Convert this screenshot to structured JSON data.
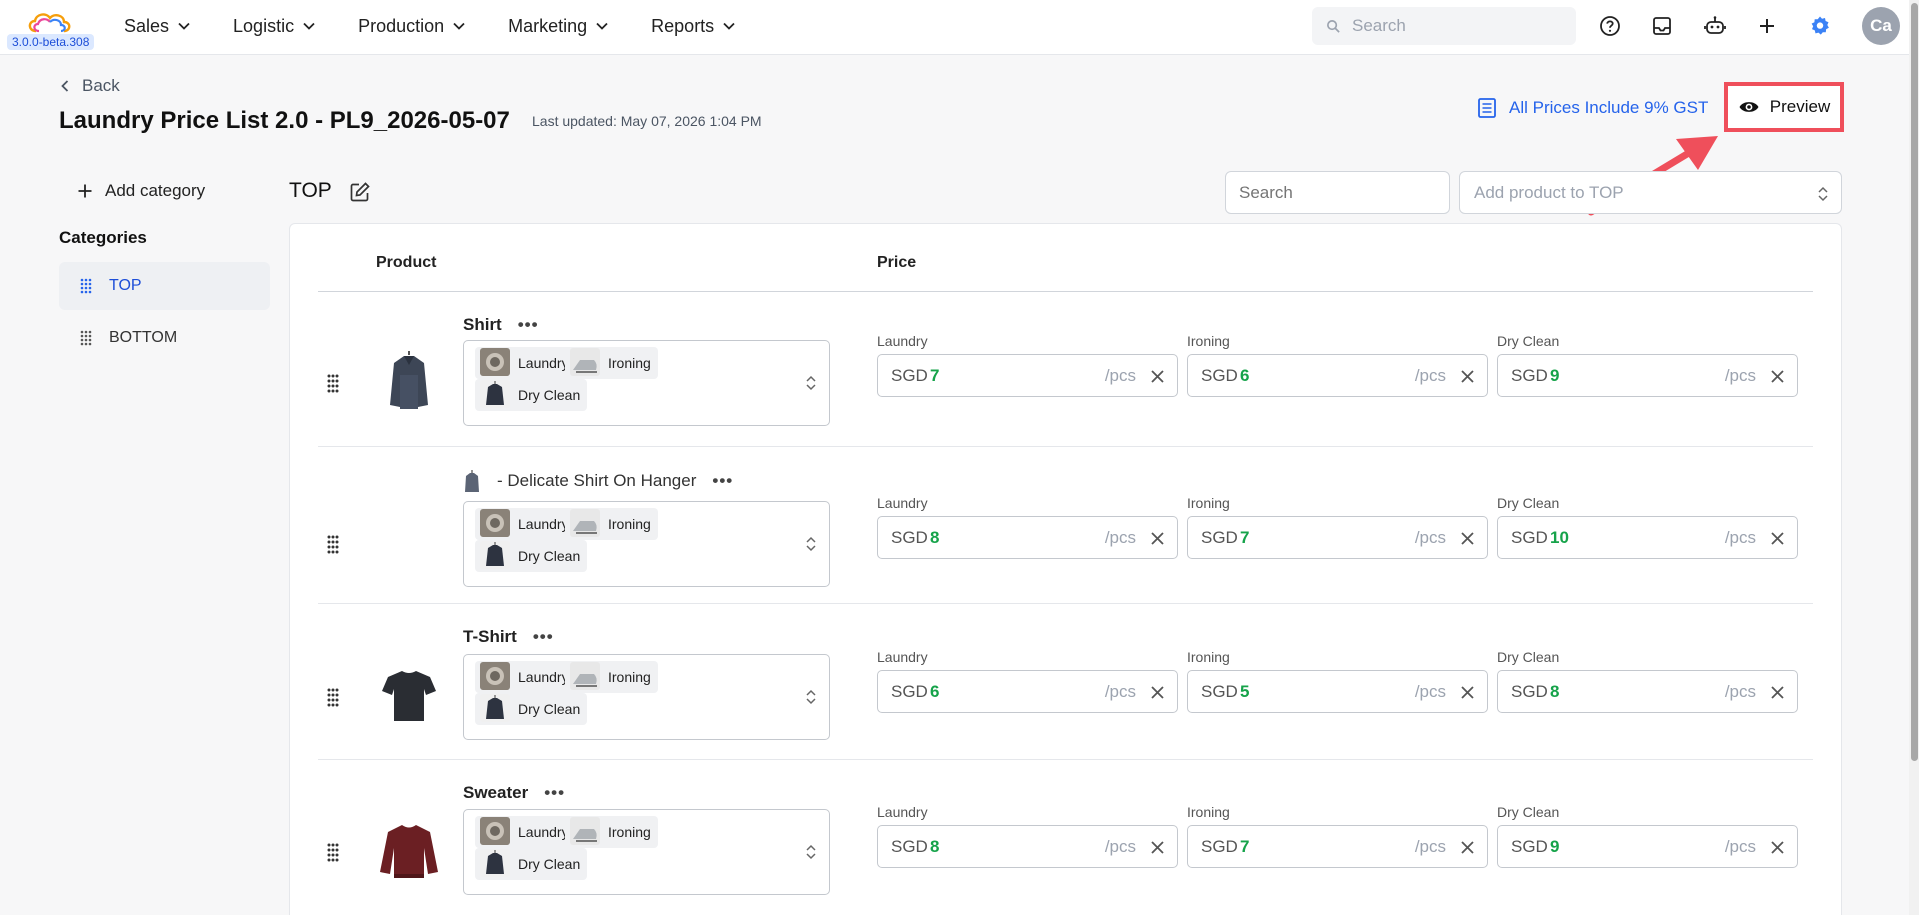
{
  "app": {
    "version": "3.0.0-beta.308"
  },
  "nav": {
    "items": [
      "Sales",
      "Logistic",
      "Production",
      "Marketing",
      "Reports"
    ]
  },
  "topbar": {
    "search_placeholder": "Search",
    "avatar_initials": "Ca"
  },
  "header": {
    "back_label": "Back",
    "title": "Laundry Price List 2.0 - PL9_2026-05-07",
    "last_updated": "Last updated: May 07, 2026 1:04 PM",
    "gst_label": "All Prices Include 9% GST",
    "preview_label": "Preview"
  },
  "sidebar": {
    "add_category": "Add category",
    "heading": "Categories",
    "categories": [
      {
        "label": "TOP",
        "active": true
      },
      {
        "label": "BOTTOM",
        "active": false
      }
    ]
  },
  "main": {
    "section_title": "TOP",
    "search_placeholder": "Search",
    "add_product_placeholder": "Add product to TOP",
    "columns": {
      "product": "Product",
      "price": "Price"
    },
    "currency": "SGD",
    "unit": "/pcs",
    "services": [
      "Laundry",
      "Ironing",
      "Dry Clean"
    ],
    "products": [
      {
        "name": "Shirt",
        "prices": [
          "7",
          "6",
          "9"
        ]
      },
      {
        "name": "- Delicate Shirt On Hanger",
        "prices": [
          "8",
          "7",
          "10"
        ]
      },
      {
        "name": "T-Shirt",
        "prices": [
          "6",
          "5",
          "8"
        ]
      },
      {
        "name": "Sweater",
        "prices": [
          "8",
          "7",
          "9"
        ]
      }
    ]
  },
  "colors": {
    "accent": "#2563eb",
    "price_value": "#16a34a",
    "highlight": "#ef4f5b"
  }
}
